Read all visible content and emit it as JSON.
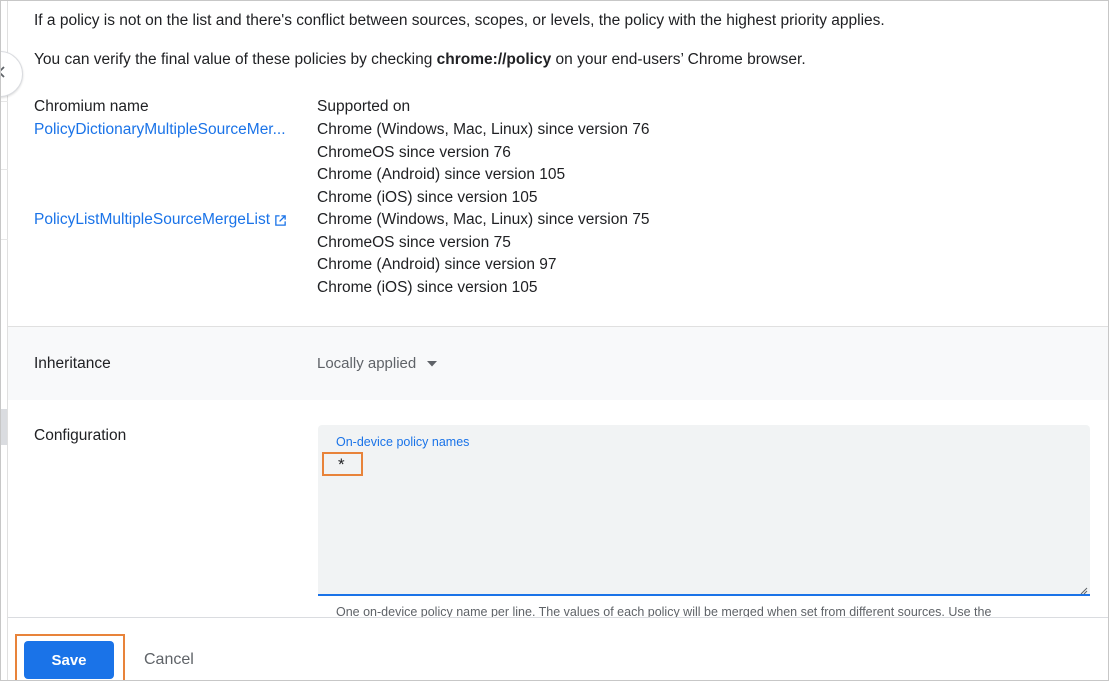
{
  "intro": {
    "line1": "If a policy is not on the list and there's conflict between sources, scopes, or levels, the policy with the highest priority applies.",
    "line2_prefix": "You can verify the final value of these policies by checking ",
    "line2_bold": "chrome://policy",
    "line2_suffix": " on your end-users’ Chrome browser."
  },
  "policy_table": {
    "col_name_header": "Chromium name",
    "col_supported_header": "Supported on",
    "rows": [
      {
        "name": "PolicyDictionaryMultipleSourceMer...",
        "supported": [
          "Chrome (Windows, Mac, Linux) since version 76",
          "ChromeOS since version 76",
          "Chrome (Android) since version 105",
          "Chrome (iOS) since version 105"
        ]
      },
      {
        "name": "PolicyListMultipleSourceMergeList",
        "supported": [
          "Chrome (Windows, Mac, Linux) since version 75",
          "ChromeOS since version 75",
          "Chrome (Android) since version 97",
          "Chrome (iOS) since version 105"
        ]
      }
    ]
  },
  "inheritance": {
    "label": "Inheritance",
    "value": "Locally applied"
  },
  "configuration": {
    "label": "Configuration",
    "field_label": "On-device policy names",
    "field_value": "*",
    "helper": "One on-device policy name per line. The values of each policy will be merged when set from different sources. Use the"
  },
  "footer": {
    "save_label": "Save",
    "cancel_label": "Cancel"
  },
  "colors": {
    "link": "#1a73e8",
    "primary_button": "#1a73e8",
    "highlight_outline": "#e8833a"
  },
  "icons": {
    "collapse": "chevron-left-icon",
    "external_link": "external-link-icon",
    "dropdown": "caret-down-icon"
  }
}
